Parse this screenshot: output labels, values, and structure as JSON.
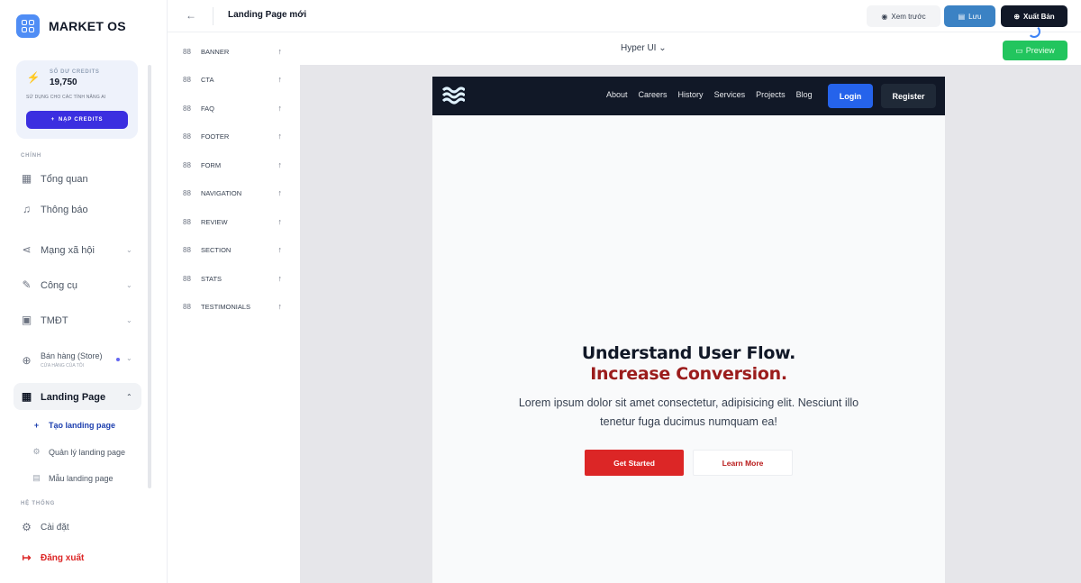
{
  "brand": {
    "name": "MARKET OS",
    "icon": "grid-icon",
    "color": "#4f8df5"
  },
  "credits": {
    "title": "SỐ DƯ CREDITS",
    "value": "19,750",
    "subtitle": "SỬ DỤNG CHO CÁC TÍNH NĂNG AI",
    "button": "NẠP CREDITS",
    "button_icon": "+"
  },
  "sidebar": {
    "section_main": "CHÍNH",
    "overview": "Tổng quan",
    "notifications": "Thông báo",
    "social": "Mạng xã hội",
    "tools": "Công cụ",
    "ecommerce": "TMĐT",
    "store": "Bán hàng (Store)",
    "store_sub": "CỬA HÀNG CỦA TÔI",
    "landing": "Landing Page",
    "landing_sub": [
      {
        "label": "Tạo landing page",
        "icon": "+"
      },
      {
        "label": "Quản lý landing page",
        "icon": "⚙"
      },
      {
        "label": "Mẫu landing page",
        "icon": "▤"
      }
    ],
    "section_system": "HỆ THỐNG",
    "settings": "Cài đặt",
    "logout": "Đăng xuất"
  },
  "topbar": {
    "back_icon": "←",
    "title": "Landing Page mới",
    "preview": "Xem trước",
    "save": "Lưu",
    "publish": "Xuất Bản"
  },
  "components": [
    "BANNER",
    "CTA",
    "FAQ",
    "FOOTER",
    "FORM",
    "NAVIGATION",
    "REVIEW",
    "SECTION",
    "STATS",
    "TESTIMONIALS"
  ],
  "canvas": {
    "theme": "Hyper UI",
    "preview_button": "Preview",
    "background": "#e6e6ea"
  },
  "landing": {
    "nav_links": [
      "About",
      "Careers",
      "History",
      "Services",
      "Projects",
      "Blog"
    ],
    "login": "Login",
    "register": "Register",
    "headline": "Understand User Flow.",
    "headline_accent": "Increase Conversion.",
    "paragraph": "Lorem ipsum dolor sit amet consectetur, adipisicing elit. Nesciunt illo tenetur fuga ducimus numquam ea!",
    "cta_primary": "Get Started",
    "cta_secondary": "Learn More",
    "accent_color": "#9b1c1c"
  }
}
